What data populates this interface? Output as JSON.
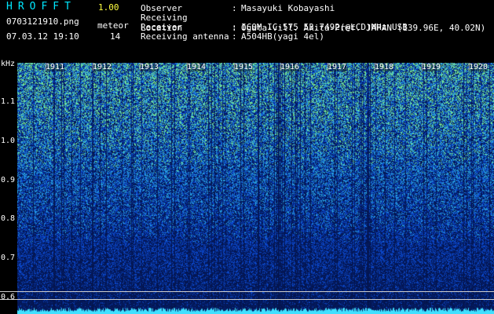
{
  "app": {
    "title": "HROFFT",
    "version": "1.00"
  },
  "file": {
    "name": "0703121910.png",
    "datetime": "07.03.12 19:10"
  },
  "meteor": {
    "label": "meteor",
    "count": "14"
  },
  "info": [
    {
      "key": "Observer",
      "value": "Masayuki Kobayashi"
    },
    {
      "key": "Receiving Location",
      "value": "Ogata-vill. Akita-Pref. JAPAN (139.96E, 40.02N)"
    },
    {
      "key": "Receiver",
      "value": "ICOM IC-575 53.7492(@LCD)MHz USB"
    },
    {
      "key": "Receiving antenna",
      "value": "A504HB(yagi 4el)"
    }
  ],
  "axis": {
    "unit": "kHz",
    "labels": [
      "1.1",
      "1.0",
      "0.9",
      "0.8",
      "0.7",
      "0.6"
    ]
  },
  "time_labels": [
    "1911",
    "1912",
    "1913",
    "1914",
    "1915",
    "1916",
    "1917",
    "1918",
    "1919",
    "1920"
  ],
  "colors": {
    "background": "#000000",
    "title": "#00e8ff",
    "version": "#ffff40",
    "text": "#ffffff"
  }
}
